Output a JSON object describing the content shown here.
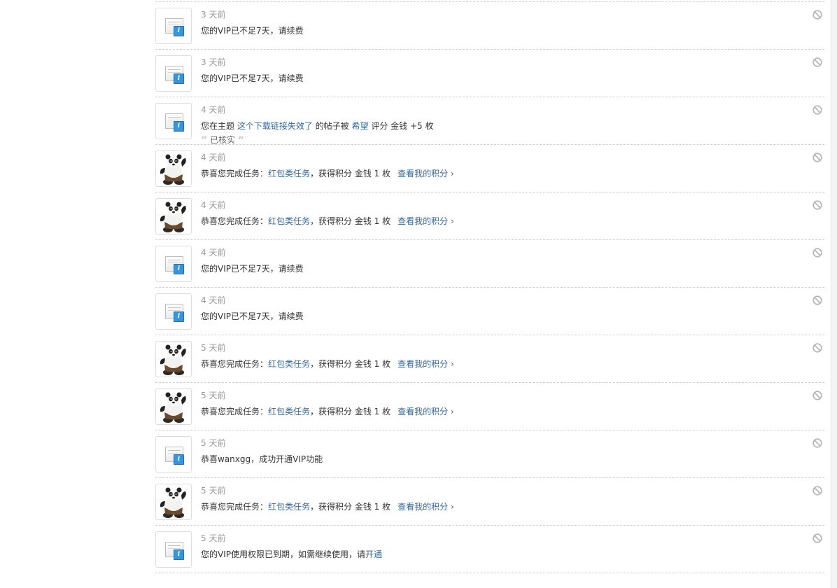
{
  "notices": [
    {
      "type": "system",
      "time": "3 天前",
      "parts": [
        {
          "text": "您的VIP已不足7天，请续费",
          "link": false
        }
      ]
    },
    {
      "type": "system",
      "time": "3 天前",
      "parts": [
        {
          "text": "您的VIP已不足7天，请续费",
          "link": false
        }
      ]
    },
    {
      "type": "system",
      "time": "4 天前",
      "parts": [
        {
          "text": "您在主题 ",
          "link": false
        },
        {
          "text": "这个下载链接失效了",
          "link": true
        },
        {
          "text": " 的帖子被 ",
          "link": false
        },
        {
          "text": "希望",
          "link": true
        },
        {
          "text": " 评分 金钱 +5 枚",
          "link": false
        }
      ],
      "quote": "已核实"
    },
    {
      "type": "panda",
      "time": "4 天前",
      "parts": [
        {
          "text": "恭喜您完成任务：",
          "link": false
        },
        {
          "text": "红包类任务",
          "link": true
        },
        {
          "text": "，获得积分 金钱 1 枚",
          "link": false
        },
        {
          "text": "查看我的积分 ›",
          "link": true,
          "gap": true
        }
      ]
    },
    {
      "type": "panda",
      "time": "4 天前",
      "parts": [
        {
          "text": "恭喜您完成任务：",
          "link": false
        },
        {
          "text": "红包类任务",
          "link": true
        },
        {
          "text": "，获得积分 金钱 1 枚",
          "link": false
        },
        {
          "text": "查看我的积分 ›",
          "link": true,
          "gap": true
        }
      ]
    },
    {
      "type": "system",
      "time": "4 天前",
      "parts": [
        {
          "text": "您的VIP已不足7天，请续费",
          "link": false
        }
      ]
    },
    {
      "type": "system",
      "time": "4 天前",
      "parts": [
        {
          "text": "您的VIP已不足7天，请续费",
          "link": false
        }
      ]
    },
    {
      "type": "panda",
      "time": "5 天前",
      "parts": [
        {
          "text": "恭喜您完成任务：",
          "link": false
        },
        {
          "text": "红包类任务",
          "link": true
        },
        {
          "text": "，获得积分 金钱 1 枚",
          "link": false
        },
        {
          "text": "查看我的积分 ›",
          "link": true,
          "gap": true
        }
      ]
    },
    {
      "type": "panda",
      "time": "5 天前",
      "parts": [
        {
          "text": "恭喜您完成任务：",
          "link": false
        },
        {
          "text": "红包类任务",
          "link": true
        },
        {
          "text": "，获得积分 金钱 1 枚",
          "link": false
        },
        {
          "text": "查看我的积分 ›",
          "link": true,
          "gap": true
        }
      ]
    },
    {
      "type": "system",
      "time": "5 天前",
      "parts": [
        {
          "text": "恭喜wanxgg，成功开通VIP功能",
          "link": false
        }
      ]
    },
    {
      "type": "panda",
      "time": "5 天前",
      "parts": [
        {
          "text": "恭喜您完成任务：",
          "link": false
        },
        {
          "text": "红包类任务",
          "link": true
        },
        {
          "text": "，获得积分 金钱 1 枚",
          "link": false
        },
        {
          "text": "查看我的积分 ›",
          "link": true,
          "gap": true
        }
      ]
    },
    {
      "type": "system",
      "time": "5 天前",
      "parts": [
        {
          "text": "您的VIP使用权限已到期，如需继续使用，请",
          "link": false
        },
        {
          "text": "开通",
          "link": true
        }
      ]
    }
  ]
}
